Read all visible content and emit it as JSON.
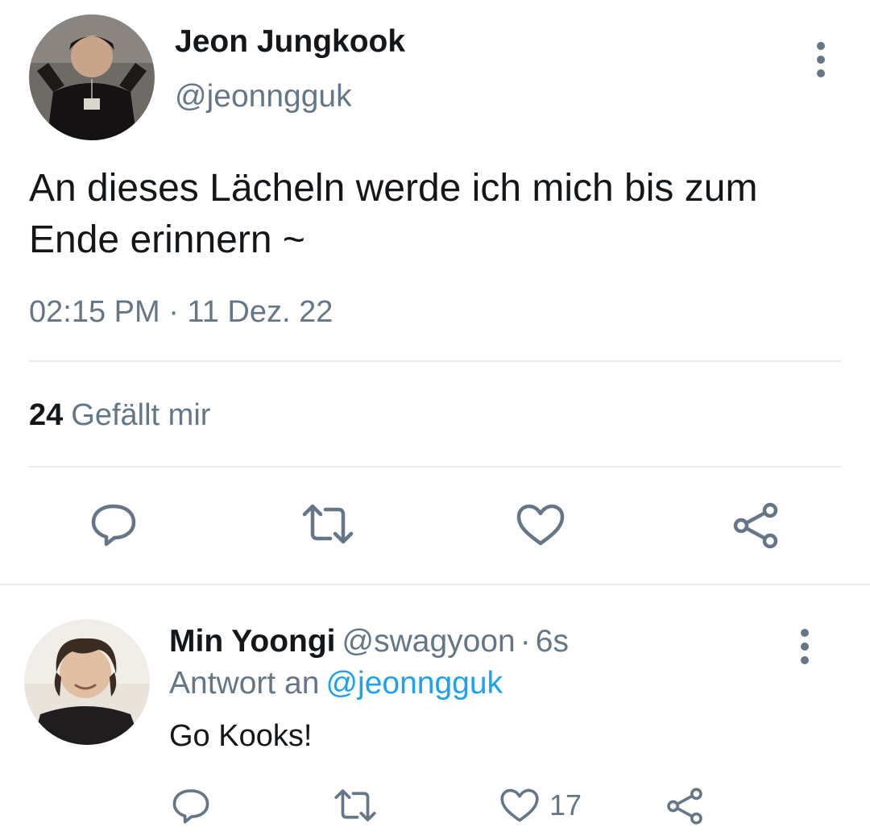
{
  "tweet": {
    "author": {
      "name": "Jeon Jungkook",
      "handle": "@jeonngguk"
    },
    "text": "An dieses Lächeln werde ich mich bis zum Ende erinnern ~",
    "timestamp": "02:15 PM · 11 Dez. 22",
    "likes": {
      "count": "24",
      "label": "Gefällt mir"
    },
    "actions": [
      "reply-icon",
      "retweet-icon",
      "like-icon",
      "share-icon"
    ]
  },
  "reply": {
    "author": {
      "name": "Min Yoongi",
      "handle": "@swagyoon"
    },
    "separator": "·",
    "age": "6s",
    "reply_to_label": "Antwort an",
    "reply_to_handle": "@jeonngguk",
    "text": "Go Kooks!",
    "like_count": "17",
    "actions": [
      "reply-icon",
      "retweet-icon",
      "like-icon",
      "share-icon"
    ]
  },
  "colors": {
    "text_primary": "#14171a",
    "text_secondary": "#657786",
    "link": "#1da1f2",
    "divider": "#e6ecf0",
    "icon": "#657786"
  }
}
